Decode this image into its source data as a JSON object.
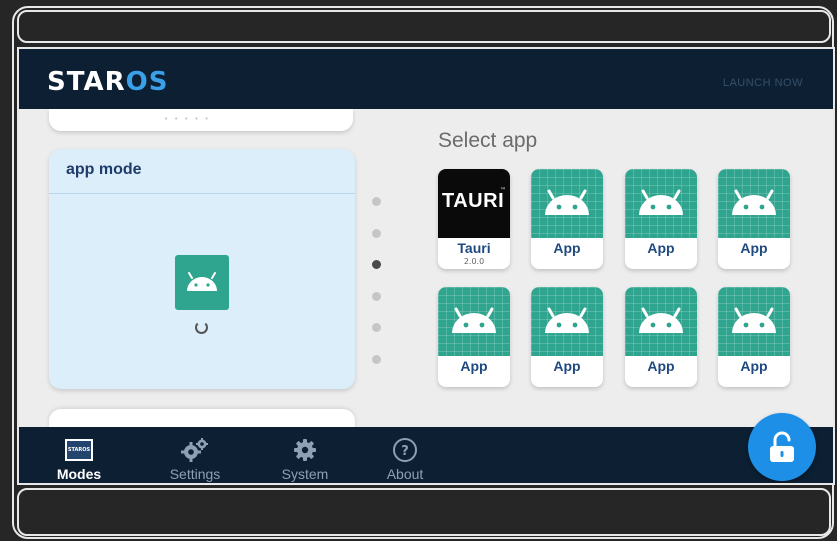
{
  "header": {
    "logo_prefix": "STAR",
    "logo_suffix": "OS",
    "launch_label": "LAUNCH NOW"
  },
  "mode_card": {
    "title": "app mode",
    "icon": "android-icon"
  },
  "pager": {
    "count": 6,
    "active_index": 2
  },
  "apps": {
    "title": "Select app",
    "items": [
      {
        "label": "Tauri",
        "version": "2.0.0",
        "logo_text": "TAURI",
        "logo_mark": "™"
      },
      {
        "label": "App"
      },
      {
        "label": "App"
      },
      {
        "label": "App"
      },
      {
        "label": "App"
      },
      {
        "label": "App"
      },
      {
        "label": "App"
      },
      {
        "label": "App"
      }
    ]
  },
  "nav": {
    "modes": {
      "label": "Modes",
      "icon_text": "STAROS"
    },
    "settings": {
      "label": "Settings"
    },
    "system": {
      "label": "System"
    },
    "about": {
      "label": "About"
    }
  },
  "colors": {
    "bar": "#0c1f33",
    "accent": "#3aa0e8",
    "app_green": "#2fa58f",
    "lock_button": "#1e8fe6"
  }
}
